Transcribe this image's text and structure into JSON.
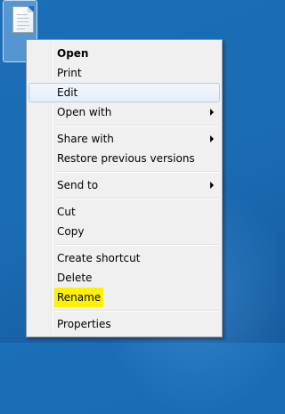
{
  "desktop": {
    "file_icon": "text-document-icon"
  },
  "menu": {
    "items": [
      {
        "label": "Open",
        "submenu": false
      },
      {
        "label": "Print",
        "submenu": false
      },
      {
        "label": "Edit",
        "submenu": false
      },
      {
        "label": "Open with",
        "submenu": true
      },
      {
        "label": "Share with",
        "submenu": true
      },
      {
        "label": "Restore previous versions",
        "submenu": false
      },
      {
        "label": "Send to",
        "submenu": true
      },
      {
        "label": "Cut",
        "submenu": false
      },
      {
        "label": "Copy",
        "submenu": false
      },
      {
        "label": "Create shortcut",
        "submenu": false
      },
      {
        "label": "Delete",
        "submenu": false
      },
      {
        "label": "Rename",
        "submenu": false
      },
      {
        "label": "Properties",
        "submenu": false
      }
    ],
    "default_item": "Open",
    "hovered_item": "Edit",
    "highlighted_item": "Rename"
  },
  "colors": {
    "desktop_background": "#1b6fb6",
    "highlight": "#fff200",
    "menu_background": "#f0f0f0"
  }
}
